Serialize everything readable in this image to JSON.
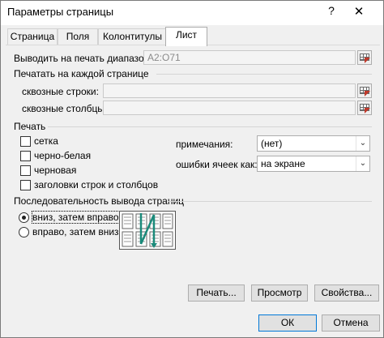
{
  "window": {
    "title": "Параметры страницы",
    "help_glyph": "?",
    "close_glyph": "✕"
  },
  "tabs": [
    {
      "label": "Страница",
      "active": false
    },
    {
      "label": "Поля",
      "active": false
    },
    {
      "label": "Колонтитулы",
      "active": false
    },
    {
      "label": "Лист",
      "active": true
    }
  ],
  "print_area": {
    "label": "Выводить на печать диапазон:",
    "value": "A2:O71"
  },
  "print_titles": {
    "heading": "Печатать на каждой странице",
    "rows_label": "сквозные строки:",
    "rows_value": "",
    "cols_label": "сквозные столбцы:",
    "cols_value": ""
  },
  "print": {
    "heading": "Печать",
    "checkboxes": [
      {
        "label": "сетка",
        "checked": false
      },
      {
        "label": "черно-белая",
        "checked": false
      },
      {
        "label": "черновая",
        "checked": false
      },
      {
        "label": "заголовки строк и столбцов",
        "checked": false
      }
    ],
    "comments_label": "примечания:",
    "comments_value": "(нет)",
    "errors_label": "ошибки ячеек как:",
    "errors_value": "на экране"
  },
  "page_order": {
    "heading": "Последовательность вывода страниц",
    "options": [
      {
        "label": "вниз, затем вправо",
        "checked": true
      },
      {
        "label": "вправо, затем вниз",
        "checked": false
      }
    ]
  },
  "actions": {
    "print_label": "Печать...",
    "preview_label": "Просмотр",
    "properties_label": "Свойства..."
  },
  "footer": {
    "ok_label": "ОК",
    "cancel_label": "Отмена"
  },
  "colors": {
    "accent": "#0078d7",
    "preview_arrow": "#1a8a7a",
    "ref_arrow": "#c0392b"
  }
}
